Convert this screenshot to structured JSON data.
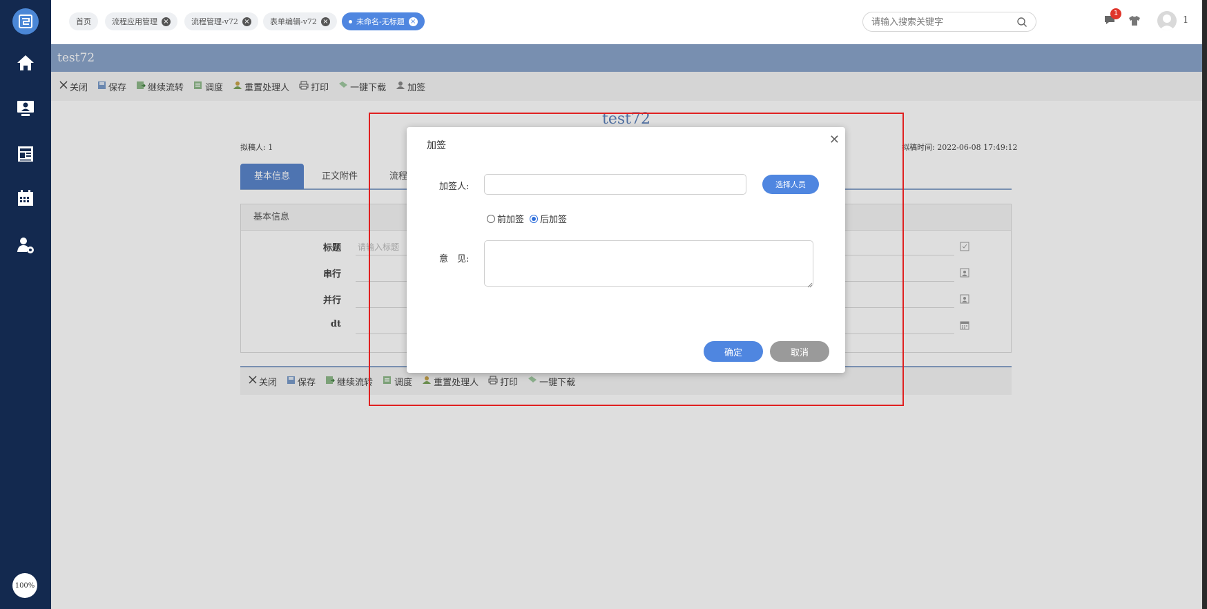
{
  "sidebar": {
    "icons": [
      "home-icon",
      "monitor-user-icon",
      "newspaper-icon",
      "calendar-icon",
      "user-settings-icon"
    ],
    "zoom": "100%"
  },
  "topbar": {
    "tabs": [
      {
        "label": "首页",
        "closable": false
      },
      {
        "label": "流程应用管理",
        "closable": true
      },
      {
        "label": "流程管理-v72",
        "closable": true
      },
      {
        "label": "表单编辑-v72",
        "closable": true
      },
      {
        "label": "未命名-无标题",
        "closable": true,
        "active": true
      }
    ],
    "search_placeholder": "请输入搜索关键字",
    "message_badge": "1",
    "user_name": "1"
  },
  "page": {
    "title": "test72",
    "toolbar": [
      {
        "label": "关闭",
        "icon": "close-icon"
      },
      {
        "label": "保存",
        "icon": "save-icon"
      },
      {
        "label": "继续流转",
        "icon": "forward-icon"
      },
      {
        "label": "调度",
        "icon": "dispatch-icon"
      },
      {
        "label": "重置处理人",
        "icon": "reset-handler-icon"
      },
      {
        "label": "打印",
        "icon": "print-icon"
      },
      {
        "label": "一键下载",
        "icon": "download-icon"
      },
      {
        "label": "加签",
        "icon": "add-signer-icon"
      }
    ]
  },
  "document": {
    "title": "test72",
    "drafter": "拟稿人: 1",
    "draft_time": "拟稿时间: 2022-06-08 17:49:12",
    "tabs": [
      "基本信息",
      "正文附件",
      "流程"
    ],
    "section_title": "基本信息",
    "fields": [
      {
        "label": "标题",
        "placeholder": "请输入标题",
        "icon": "edit-icon"
      },
      {
        "label": "串行",
        "placeholder": "",
        "icon": "person-icon"
      },
      {
        "label": "并行",
        "placeholder": "",
        "icon": "person-icon"
      },
      {
        "label": "dt",
        "placeholder": "",
        "icon": "calendar-icon"
      }
    ],
    "bottom_toolbar": [
      "关闭",
      "保存",
      "继续流转",
      "调度",
      "重置处理人",
      "打印",
      "一键下载"
    ]
  },
  "dialog": {
    "title": "加签",
    "signer_label": "加签人:",
    "signer_value": "",
    "select_button": "选择人员",
    "radio_before": "前加签",
    "radio_after": "后加签",
    "selected": "后加签",
    "opinion_label": "意　见:",
    "opinion_value": "",
    "ok_button": "确定",
    "cancel_button": "取消"
  }
}
